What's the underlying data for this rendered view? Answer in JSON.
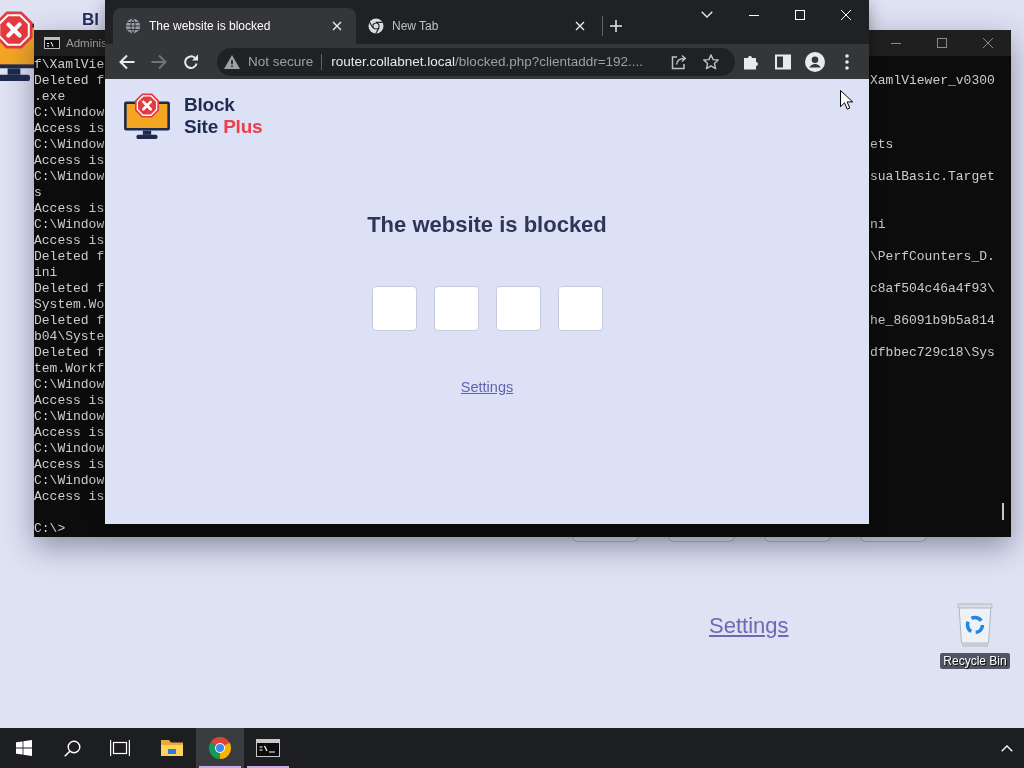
{
  "desktop": {
    "wallpaper": {
      "brand_fragment": "Bl",
      "code_fields": [
        {
          "focused": false
        },
        {
          "focused": false
        },
        {
          "focused": false
        },
        {
          "focused": false
        }
      ],
      "link": "Settings"
    },
    "icons": [
      {
        "kind": "recycle_bin",
        "label": "Recycle Bin"
      }
    ]
  },
  "console_window": {
    "title": "Adminis",
    "active": false,
    "lines": [
      {
        "start": "f\\XamlVie"
      },
      {
        "start": "Deleted f",
        "end": "XamlViewer_v0300"
      },
      {
        "start": ".exe"
      },
      {
        "start": "C:\\Window"
      },
      {
        "start": "Access is"
      },
      {
        "start": "C:\\Window",
        "end": "ets"
      },
      {
        "start": "Access is"
      },
      {
        "start": "C:\\Window",
        "end": "sualBasic.Target"
      },
      {
        "start": "s"
      },
      {
        "start": "Access is"
      },
      {
        "start": "C:\\Window",
        "end": "ni"
      },
      {
        "start": "Access is"
      },
      {
        "start": "Deleted f",
        "end": "\\PerfCounters_D."
      },
      {
        "start": "ini"
      },
      {
        "start": "Deleted f",
        "end": "c8af504c46a4f93\\"
      },
      {
        "start": "System.Wo"
      },
      {
        "start": "Deleted f",
        "end": "he_86091b9b5a814"
      },
      {
        "start": "b04\\Syste"
      },
      {
        "start": "Deleted f",
        "end": "dfbbec729c18\\Sys"
      },
      {
        "start": "tem.Workf"
      },
      {
        "start": "C:\\Window"
      },
      {
        "start": "Access is"
      },
      {
        "start": "C:\\Window"
      },
      {
        "start": "Access is"
      },
      {
        "start": "C:\\Window"
      },
      {
        "start": "Access is"
      },
      {
        "start": "C:\\Window"
      },
      {
        "start": "Access is"
      }
    ],
    "prompt": "C:\\>"
  },
  "browser_window": {
    "tabs": [
      {
        "kind": "page",
        "title": "The website is blocked",
        "selected": true
      },
      {
        "kind": "new_tab",
        "title": "New Tab",
        "selected": false
      }
    ],
    "nav_buttons": [
      {
        "kind": "back",
        "disabled": false
      },
      {
        "kind": "forward",
        "disabled": true
      },
      {
        "kind": "reload",
        "disabled": false
      }
    ],
    "address_bar": {
      "security": "Not secure",
      "host": "router.collabnet.local",
      "path": "/blocked.php?clientaddr=192...."
    },
    "page": {
      "logo": {
        "line_1": "Block",
        "line_2": "Site",
        "accent": "Plus"
      },
      "heading": "The website is blocked",
      "code_fields": [
        {
          "focused": false
        },
        {
          "focused": false
        },
        {
          "focused": false
        },
        {
          "focused": false
        }
      ],
      "link": "Settings"
    }
  },
  "taskbar": {
    "items": [
      {
        "kind": "start"
      },
      {
        "kind": "search"
      },
      {
        "kind": "task_view"
      },
      {
        "kind": "file_explorer",
        "running": false,
        "selected": false
      },
      {
        "kind": "browser",
        "running": true,
        "selected": true
      },
      {
        "kind": "terminal",
        "running": true,
        "selected": false
      }
    ]
  }
}
